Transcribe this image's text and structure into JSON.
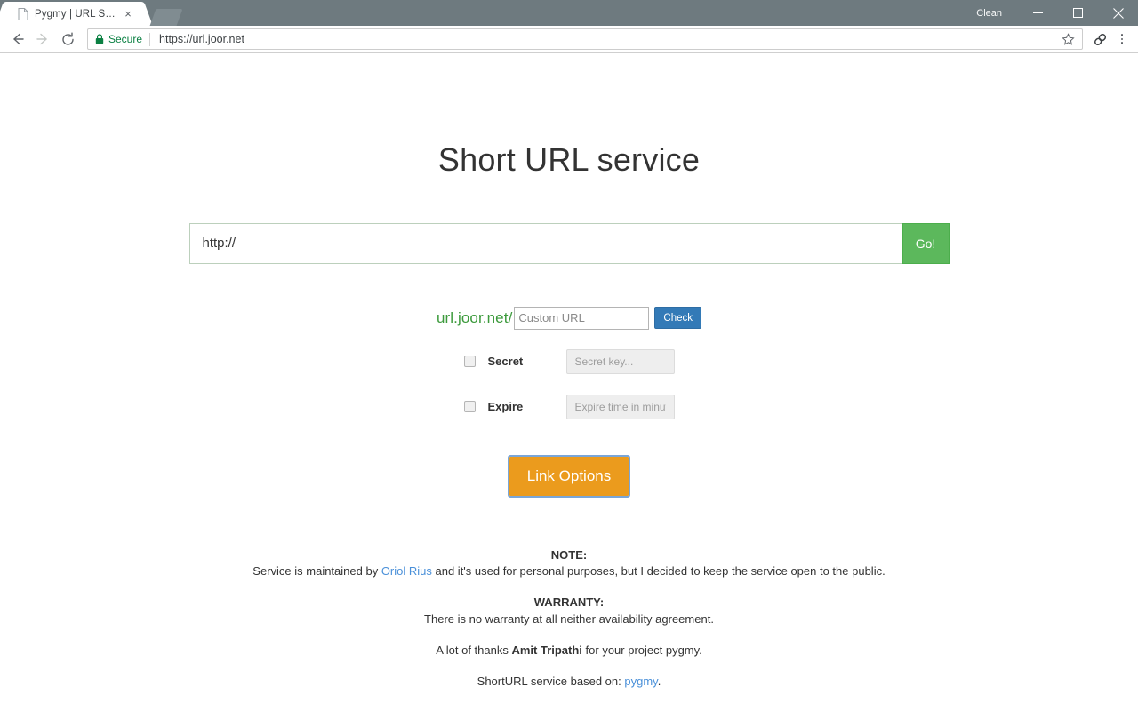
{
  "browser": {
    "tab": {
      "title": "Pygmy | URL Shortener",
      "close_label": "×",
      "favicon_name": "page-icon"
    },
    "window": {
      "profile_label": "Clean",
      "minimize_label": "Minimize",
      "maximize_label": "Maximize",
      "close_label": "Close"
    },
    "toolbar": {
      "back_label": "Back",
      "forward_label": "Forward",
      "reload_label": "Reload",
      "security_text": "Secure",
      "url": "https://url.joor.net",
      "bookmark_label": "Bookmark this page",
      "extension_label": "Link extension",
      "menu_label": "Customize and control Google Chrome"
    }
  },
  "page": {
    "title": "Short URL service",
    "url_form": {
      "input_value": "http://",
      "input_placeholder": "http://",
      "submit_label": "Go!"
    },
    "custom_form": {
      "domain_prefix": "url.joor.net/",
      "custom_placeholder": "Custom URL",
      "custom_value": "",
      "check_label": "Check"
    },
    "toggles": [
      {
        "label": "Secret",
        "checked": false,
        "placeholder": "Secret key...",
        "value": ""
      },
      {
        "label": "Expire",
        "checked": false,
        "placeholder": "Expire time in minutes",
        "value": ""
      }
    ],
    "link_options_label": "Link Options",
    "footer": {
      "note_heading": "NOTE:",
      "note_line_pre": "Service is maintained by ",
      "note_link": "Oriol Rius",
      "note_line_post": " and it's used for personal purposes, but I decided to keep the service open to the public.",
      "warranty_heading": "WARRANTY:",
      "warranty_text": "There is no warranty at all neither availability agreement.",
      "thanks_pre": "A lot of thanks ",
      "thanks_name": "Amit Tripathi",
      "thanks_post": " for your project pygmy.",
      "based_pre": "ShortURL service based on: ",
      "based_link": "pygmy",
      "based_post": "."
    }
  },
  "colors": {
    "titlebar": "#6e7a7f",
    "go_green": "#5cb85c",
    "domain_green": "#3c9a3c",
    "check_blue": "#337ab7",
    "link_options_orange": "#eb9b1d",
    "link_blue": "#4a90d9",
    "secure_green": "#0b8043"
  }
}
